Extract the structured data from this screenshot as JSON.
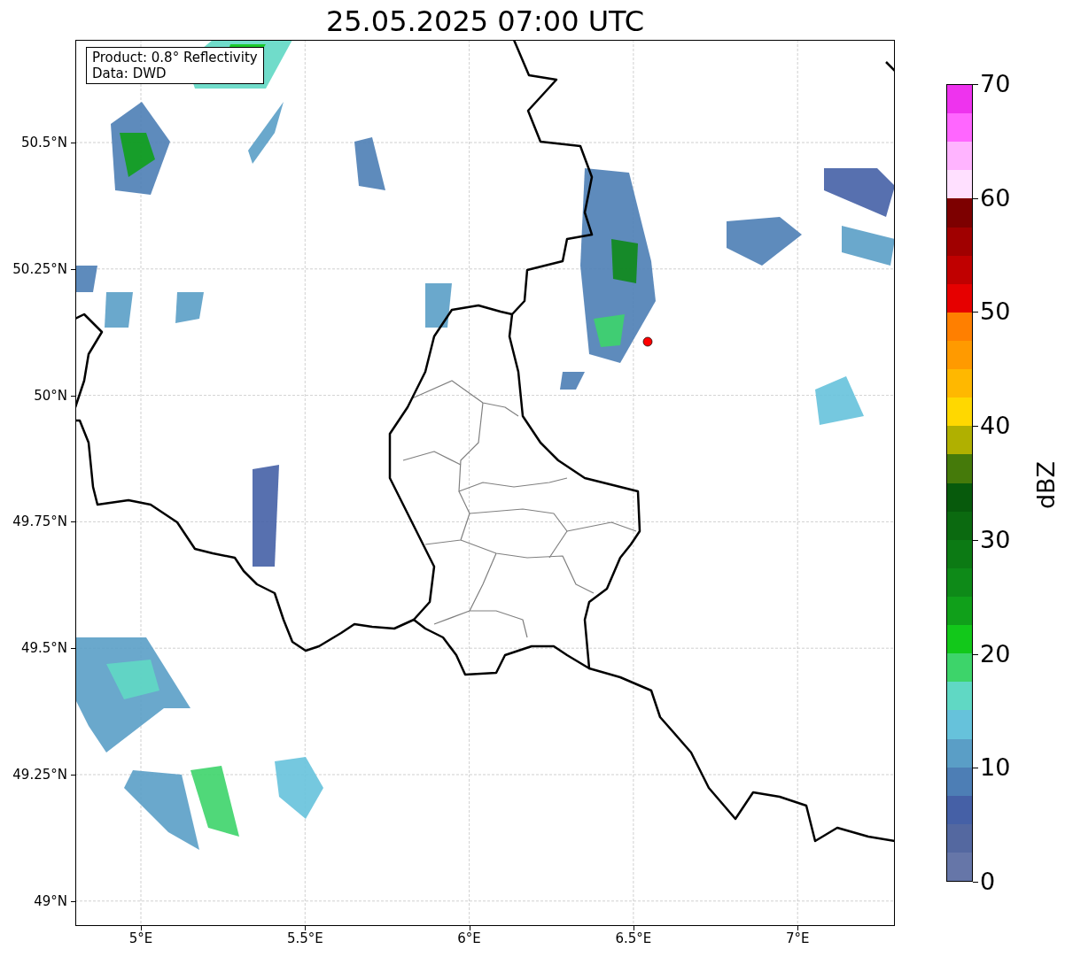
{
  "title": "25.05.2025 07:00 UTC",
  "map": {
    "info": [
      "Product: 0.8° Reflectivity",
      "Data: DWD"
    ],
    "lat_labels": [
      "50.5°N",
      "50.25°N",
      "50°N",
      "49.75°N",
      "49.5°N",
      "49.25°N",
      "49°N"
    ],
    "lon_labels": [
      "5°E",
      "5.5°E",
      "6°E",
      "6.5°E",
      "7°E"
    ]
  },
  "colorbar": {
    "label": "dBZ",
    "ticks": [
      "70",
      "60",
      "50",
      "40",
      "30",
      "20",
      "10",
      "0"
    ],
    "segments": [
      {
        "color": "#ee33ee"
      },
      {
        "color": "#ff66ff"
      },
      {
        "color": "#ffb4ff"
      },
      {
        "color": "#ffe0ff"
      },
      {
        "color": "#7d0000"
      },
      {
        "color": "#a00000"
      },
      {
        "color": "#c00000"
      },
      {
        "color": "#e60000"
      },
      {
        "color": "#ff7f00"
      },
      {
        "color": "#ff9a00"
      },
      {
        "color": "#ffb800"
      },
      {
        "color": "#ffd800"
      },
      {
        "color": "#b0b000"
      },
      {
        "color": "#457a0a"
      },
      {
        "color": "#075a0c"
      },
      {
        "color": "#0b6a10"
      },
      {
        "color": "#0c7a14"
      },
      {
        "color": "#0e8a18"
      },
      {
        "color": "#10a01a"
      },
      {
        "color": "#12c81a"
      },
      {
        "color": "#3dd46a"
      },
      {
        "color": "#60d8c4"
      },
      {
        "color": "#66c2db"
      },
      {
        "color": "#5a9ec6"
      },
      {
        "color": "#4d7eb5"
      },
      {
        "color": "#4560a6"
      },
      {
        "color": "#5468a0"
      },
      {
        "color": "#6676a8"
      }
    ]
  }
}
